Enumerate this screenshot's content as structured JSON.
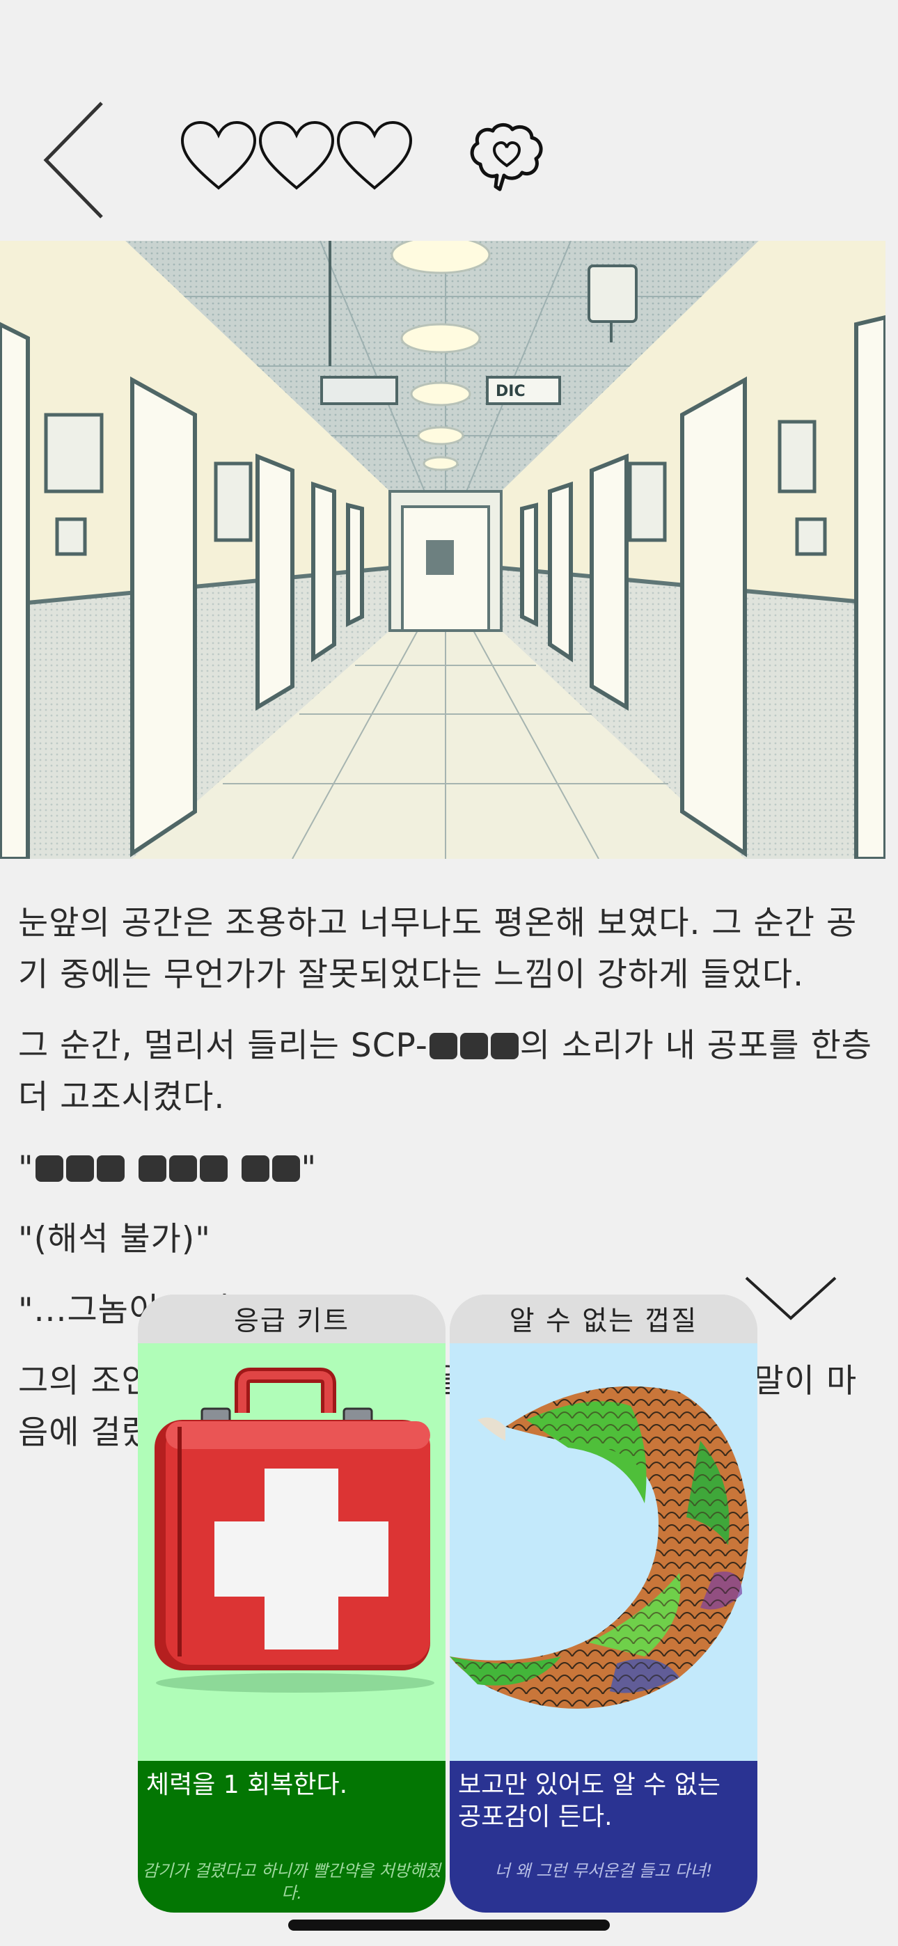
{
  "header": {
    "back_icon": "chevron-left-icon",
    "hearts": {
      "filled": 0,
      "total": 3,
      "icon": "heart-outline-icon"
    },
    "mind_icon": "brain-heart-icon"
  },
  "scene": {
    "description_icon": "hallway-illustration",
    "door_sign": "DIC"
  },
  "story": {
    "p1": "눈앞의 공간은 조용하고 너무나도 평온해 보였다. 그 순간 공기 중에는 무언가가 잘못되었다는 느낌이 강하게 들었다.",
    "p2_pre": "그 순간, 멀리서 들리는 SCP-",
    "p2_post": "의 소리가 내 공포를 한층 더 고조시켰다.",
    "p3_quote_open": "\"",
    "p3_quote_close": "\"",
    "p4": "\"(해석 불가)\"",
    "p5": "\"...그놈이 온다.\"",
    "p6": "그의 조언대로 나는 빨리 이곳을 떠나야 했지만 그의 말이 마음에 걸렸다."
  },
  "cards": [
    {
      "title": "응급 키트",
      "description": "체력을 1 회복한다.",
      "flavor": "감기가 걸렸다고 하니까 빨간약을 처방해줬다.",
      "icon": "first-aid-kit-icon",
      "colors": {
        "art_bg": "#b0fdb8",
        "info_bg": "#037603"
      }
    },
    {
      "title": "알 수 없는 껍질",
      "description": "보고만 있어도 알 수 없는 공포감이 든다.",
      "flavor": "너 왜 그런 무서운걸 들고 다녀!",
      "icon": "scaly-shell-icon",
      "colors": {
        "art_bg": "#c3e9fb",
        "info_bg": "#2a3392"
      }
    }
  ],
  "collapse_icon": "chevron-down-icon"
}
